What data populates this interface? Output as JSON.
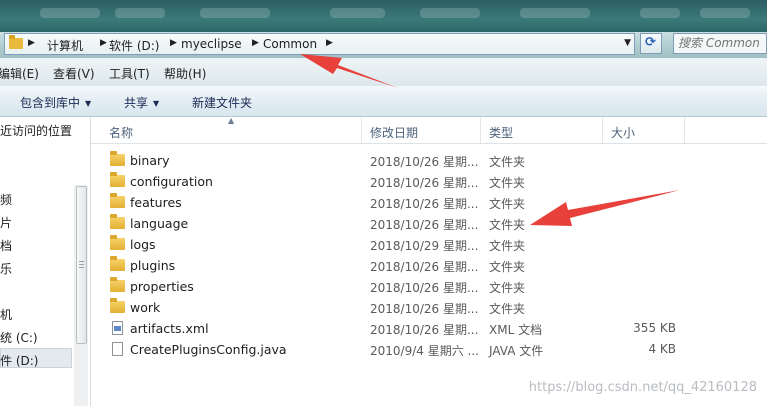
{
  "address": {
    "crumbs": [
      "计算机",
      "软件 (D:)",
      "myeclipse",
      "Common"
    ]
  },
  "search": {
    "placeholder": "搜索 Common"
  },
  "menu": [
    "编辑(E)",
    "查看(V)",
    "工具(T)",
    "帮助(H)"
  ],
  "toolbar": {
    "include_library": "包含到库中",
    "share": "共享",
    "new_folder": "新建文件夹"
  },
  "nav": {
    "items": [
      "近访问的位置",
      "频",
      "片",
      "档",
      "乐",
      "机",
      "统 (C:)",
      "件 (D:)"
    ]
  },
  "columns": {
    "name": "名称",
    "date": "修改日期",
    "type": "类型",
    "size": "大小"
  },
  "files": [
    {
      "name": "binary",
      "date": "2018/10/26 星期...",
      "type": "文件夹",
      "size": "",
      "icon": "folder-icon"
    },
    {
      "name": "configuration",
      "date": "2018/10/26 星期...",
      "type": "文件夹",
      "size": "",
      "icon": "folder-icon"
    },
    {
      "name": "features",
      "date": "2018/10/26 星期...",
      "type": "文件夹",
      "size": "",
      "icon": "folder-icon"
    },
    {
      "name": "language",
      "date": "2018/10/26 星期...",
      "type": "文件夹",
      "size": "",
      "icon": "folder-icon"
    },
    {
      "name": "logs",
      "date": "2018/10/29 星期...",
      "type": "文件夹",
      "size": "",
      "icon": "folder-icon"
    },
    {
      "name": "plugins",
      "date": "2018/10/26 星期...",
      "type": "文件夹",
      "size": "",
      "icon": "folder-icon"
    },
    {
      "name": "properties",
      "date": "2018/10/26 星期...",
      "type": "文件夹",
      "size": "",
      "icon": "folder-icon"
    },
    {
      "name": "work",
      "date": "2018/10/26 星期...",
      "type": "文件夹",
      "size": "",
      "icon": "folder-icon"
    },
    {
      "name": "artifacts.xml",
      "date": "2018/10/26 星期...",
      "type": "XML 文档",
      "size": "355 KB",
      "icon": "xml-file-icon"
    },
    {
      "name": "CreatePluginsConfig.java",
      "date": "2010/9/4 星期六 ...",
      "type": "JAVA 文件",
      "size": "4 KB",
      "icon": "file-icon"
    }
  ],
  "watermark": "https://blog.csdn.net/qq_42160128",
  "colors": {
    "annotation_arrow": "#e8403a",
    "folder": "#e4b033"
  }
}
